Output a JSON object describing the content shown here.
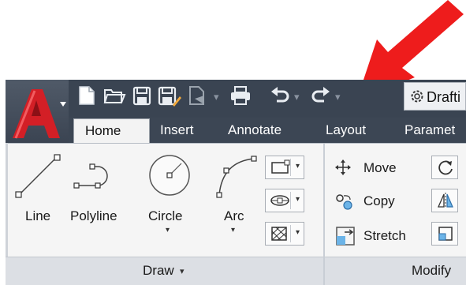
{
  "quick_access": {
    "icons": [
      "new-icon",
      "open-icon",
      "save-icon",
      "save-as-icon",
      "publish-icon",
      "print-icon",
      "undo-icon",
      "redo-icon"
    ],
    "workspace_label": "Drafti"
  },
  "tabs": [
    {
      "label": "Home"
    },
    {
      "label": "Insert"
    },
    {
      "label": "Annotate"
    },
    {
      "label": "Layout"
    },
    {
      "label": "Paramet"
    }
  ],
  "draw_panel": {
    "tools": [
      {
        "label": "Line"
      },
      {
        "label": "Polyline"
      },
      {
        "label": "Circle"
      },
      {
        "label": "Arc"
      }
    ],
    "panel_label": "Draw",
    "dropdown_arrow": "▾"
  },
  "modify_panel": {
    "tools": [
      {
        "label": "Move"
      },
      {
        "label": "Copy"
      },
      {
        "label": "Stretch"
      }
    ],
    "panel_label": "Modify"
  },
  "colors": {
    "annotation_arrow": "#ee1c1c",
    "title_bar": "#3a4452",
    "app_logo": "#d31f26"
  }
}
